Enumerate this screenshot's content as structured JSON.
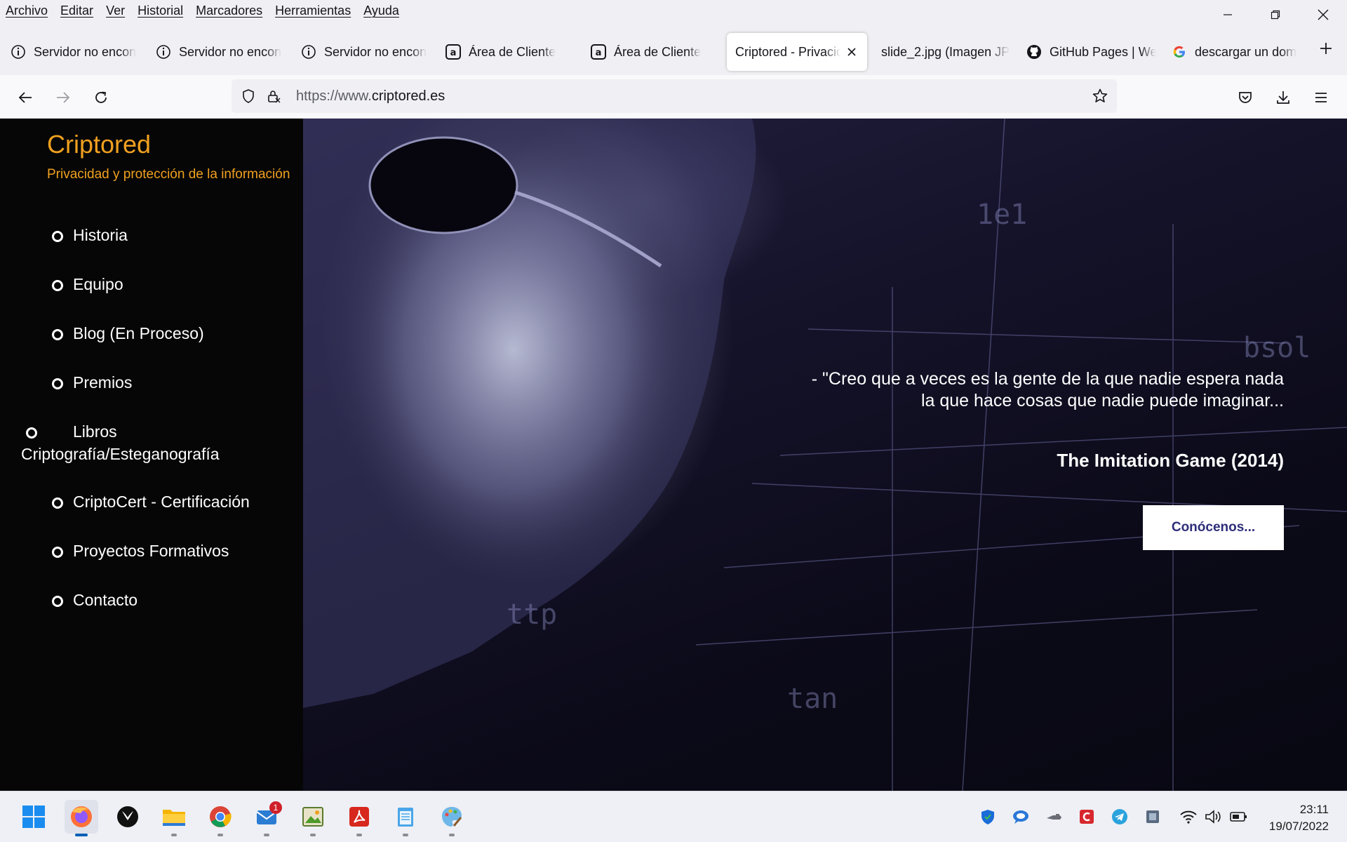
{
  "menubar": {
    "items": [
      "Archivo",
      "Editar",
      "Ver",
      "Historial",
      "Marcadores",
      "Herramientas",
      "Ayuda"
    ]
  },
  "tabs": [
    {
      "title": "Servidor no encon",
      "icon": "info-icon"
    },
    {
      "title": "Servidor no encon",
      "icon": "info-icon"
    },
    {
      "title": "Servidor no encon",
      "icon": "info-icon"
    },
    {
      "title": "Área de Cliente",
      "icon": "a-brand-icon"
    },
    {
      "title": "Área de Cliente",
      "icon": "a-brand-icon"
    },
    {
      "title": "Criptored - Privacid",
      "icon": "none",
      "active": true
    },
    {
      "title": "slide_2.jpg (Imagen JP",
      "icon": "none"
    },
    {
      "title": "GitHub Pages | We",
      "icon": "github-icon"
    },
    {
      "title": "descargar un dom",
      "icon": "google-icon"
    }
  ],
  "urlbar": {
    "prefix": "https://www.",
    "domain": "criptored.es"
  },
  "site": {
    "title": "Criptored",
    "subtitle": "Privacidad y protección de la información",
    "accent_color": "#f0a020",
    "nav": [
      "Historia",
      "Equipo",
      "Blog (En Proceso)",
      "Premios",
      "Libros Criptografía/Esteganografía",
      "CriptoCert - Certificación",
      "Proyectos Formativos",
      "Contacto"
    ]
  },
  "hero": {
    "quote_line1": "- \"Creo que a veces es la gente de la que nadie espera nada",
    "quote_line2": "la que hace cosas que nadie puede imaginar...",
    "source": "The Imitation Game (2014)",
    "cta_label": "Conócenos..."
  },
  "taskbar": {
    "apps": [
      "windows-start-icon",
      "firefox-icon",
      "xbox-icon",
      "file-explorer-icon",
      "chrome-icon",
      "mail-icon",
      "image-viewer-icon",
      "acrobat-icon",
      "notepad-icon",
      "paint-icon"
    ],
    "mail_badge": "1",
    "time": "23:11",
    "date": "19/07/2022"
  }
}
